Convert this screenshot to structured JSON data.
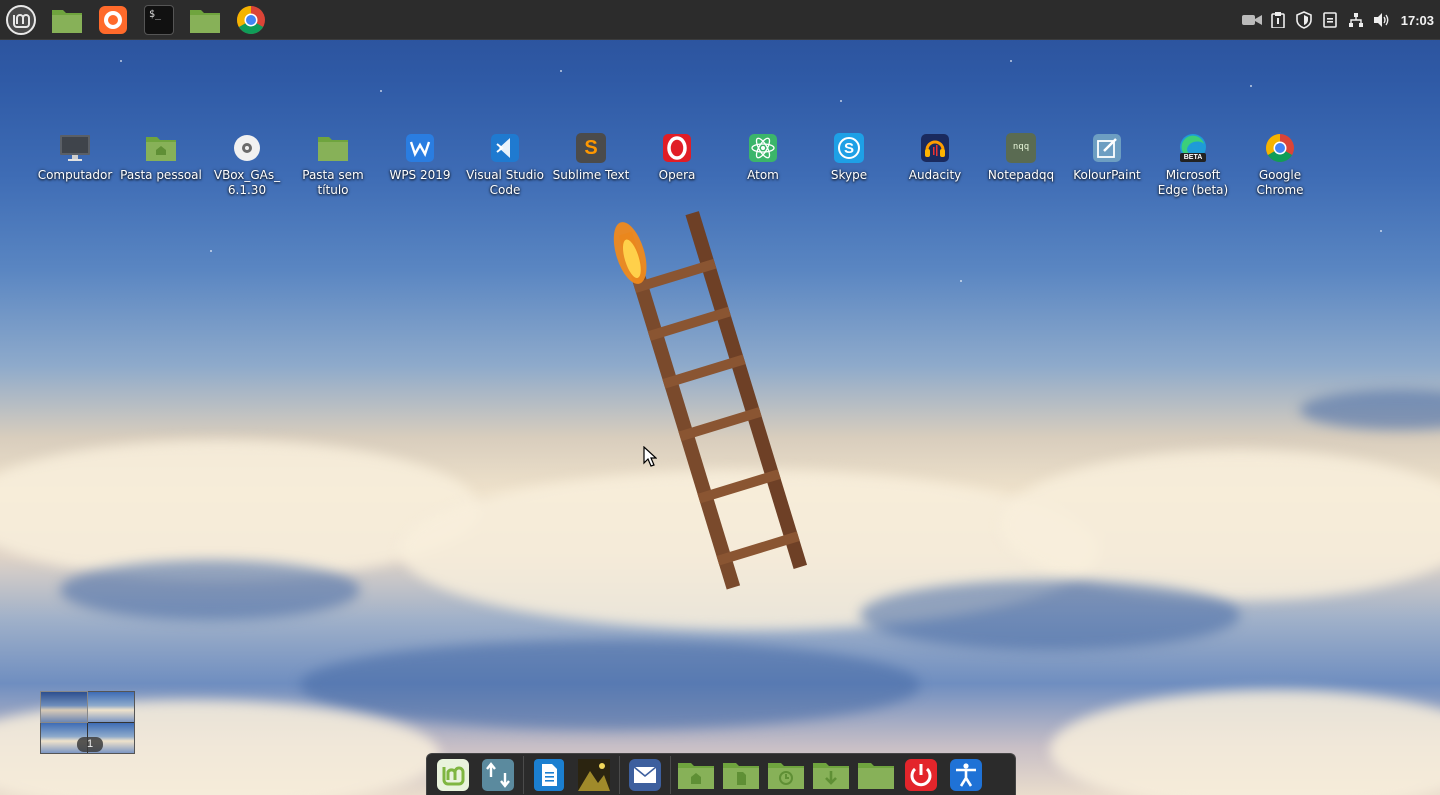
{
  "panel": {
    "launchers": [
      {
        "name": "mint-menu",
        "icon": "mint-logo-icon"
      },
      {
        "name": "files",
        "icon": "green-folder-icon"
      },
      {
        "name": "firefox",
        "icon": "firefox-icon"
      },
      {
        "name": "terminal",
        "icon": "terminal-icon",
        "text": "$_"
      },
      {
        "name": "home-folder",
        "icon": "green-folder-icon"
      },
      {
        "name": "chrome",
        "icon": "chrome-icon"
      }
    ],
    "tray": [
      "video-camera-icon",
      "clipboard-icon",
      "shield-icon",
      "notes-icon",
      "network-icon",
      "volume-icon"
    ],
    "clock": "17:03"
  },
  "desktop": {
    "icons": [
      {
        "label": "Computador",
        "icon": "computer-icon"
      },
      {
        "label": "Pasta pessoal",
        "icon": "home-folder-icon"
      },
      {
        "label": "VBox_GAs_ 6.1.30",
        "icon": "cd-icon"
      },
      {
        "label": "Pasta sem título",
        "icon": "folder-icon"
      },
      {
        "label": "WPS 2019",
        "icon": "wps-icon"
      },
      {
        "label": "Visual Studio Code",
        "icon": "vscode-icon"
      },
      {
        "label": "Sublime Text",
        "icon": "sublime-icon",
        "glyph": "S"
      },
      {
        "label": "Opera",
        "icon": "opera-icon"
      },
      {
        "label": "Atom",
        "icon": "atom-icon"
      },
      {
        "label": "Skype",
        "icon": "skype-icon",
        "glyph": "S"
      },
      {
        "label": "Audacity",
        "icon": "audacity-icon"
      },
      {
        "label": "Notepadqq",
        "icon": "notepadqq-icon",
        "glyph": "nqq"
      },
      {
        "label": "KolourPaint",
        "icon": "kolourpaint-icon"
      },
      {
        "label": "Microsoft Edge (beta)",
        "icon": "edge-beta-icon",
        "glyph": "BETA"
      },
      {
        "label": "Google Chrome",
        "icon": "chrome-icon"
      }
    ]
  },
  "workspace": {
    "current": "1"
  },
  "dock": {
    "items": [
      {
        "name": "mint-menu",
        "icon": "mint-logo-icon"
      },
      {
        "name": "update-manager",
        "icon": "update-arrows-icon"
      },
      {
        "sep": true
      },
      {
        "name": "text-editor",
        "icon": "document-icon"
      },
      {
        "name": "image-viewer",
        "icon": "picture-icon"
      },
      {
        "sep": true
      },
      {
        "name": "mail",
        "icon": "mail-icon"
      },
      {
        "sep": true
      },
      {
        "name": "home-folder",
        "icon": "home-folder-icon"
      },
      {
        "name": "documents-folder",
        "icon": "documents-folder-icon"
      },
      {
        "name": "recent-folder",
        "icon": "recent-folder-icon"
      },
      {
        "name": "downloads-folder",
        "icon": "downloads-folder-icon"
      },
      {
        "name": "folder",
        "icon": "folder-icon"
      },
      {
        "name": "power",
        "icon": "power-icon"
      },
      {
        "name": "accessibility",
        "icon": "accessibility-icon"
      }
    ]
  },
  "colors": {
    "panel_bg": "#2c2c2c",
    "mint_green": "#8bc34a",
    "folder_green": "#87b158"
  }
}
